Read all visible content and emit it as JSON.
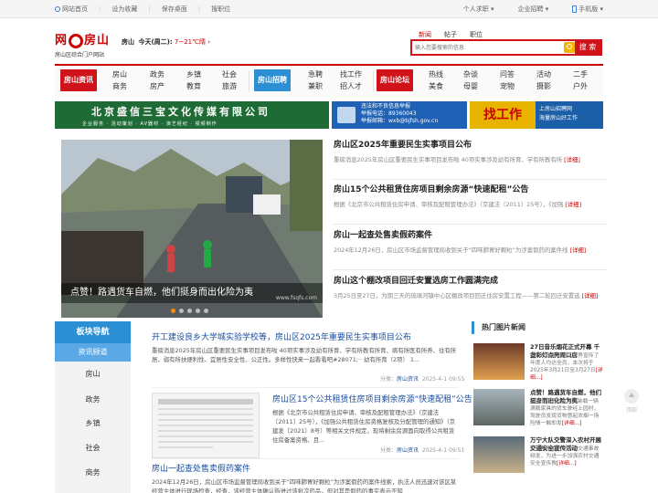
{
  "topbar": {
    "home": "网站首页",
    "favorite": "设为收藏",
    "desktop": "保存桌面",
    "report": "搜职位",
    "personal": "个人求职",
    "company": "企业招聘",
    "mobile": "手机版"
  },
  "logo": {
    "title_left": "网",
    "title_right": "房山",
    "subtitle": "房山区综合门户网站"
  },
  "weather": {
    "location": "房山",
    "today": "今天(周二):",
    "temp": "7~21℃晴"
  },
  "search": {
    "tabs": [
      "新闻",
      "帖子",
      "职位"
    ],
    "placeholder": "输入您要搜索的信息",
    "button": "搜 索"
  },
  "nav": {
    "blocks": [
      {
        "label": "房山资讯",
        "color": "#d0121b"
      },
      {
        "label": "房山招聘",
        "color": "#2c8fd4"
      },
      {
        "label": "房山论坛",
        "color": "#d0121b"
      }
    ],
    "group1": [
      [
        "房山",
        "商务"
      ],
      [
        "政务",
        "房产"
      ],
      [
        "乡镇",
        "教育"
      ],
      [
        "社会",
        "旅游"
      ]
    ],
    "group2": [
      [
        "急聘",
        "兼职"
      ],
      [
        "找工作",
        "招人才"
      ]
    ],
    "group3": [
      [
        "热线",
        "美食"
      ],
      [
        "杂谈",
        "母婴"
      ],
      [
        "问答",
        "宠物"
      ],
      [
        "活动",
        "摄影"
      ],
      [
        "二手",
        "户外"
      ]
    ]
  },
  "banners": {
    "b1_title": "北京盛信三宝文化传媒有限公司",
    "b1_sub": "企业服务 · 活动策划 · AV器材 · 演艺经纪 · 视频制作",
    "b2_line1": "违法和不良信息举报",
    "b2_line2": "举报电话：89360043",
    "b2_line3": "举报邮箱：wxb@bjfsh.gov.cn",
    "b3_big": "找工作",
    "b3_l1": "上房山招聘网",
    "b3_l2": "海量房山好工作"
  },
  "slide": {
    "caption": "点赞！路遇货车自燃，他们挺身而出化险为夷",
    "watermark": "www.fsqfs.com",
    "active_dot": 0,
    "dot_count": 5
  },
  "headlines": [
    {
      "title": "房山区2025年重要民生实事项目公布",
      "desc": "重磅消息2025年房山区重要民生实事项目发布啦 40项实事涉及幼有所育、学有所教有所",
      "more": "[详细]"
    },
    {
      "title": "房山15个公共租赁住房项目剩余房源“快速配租”公告",
      "desc": "根据《北京市公共租赁住房申请、审核及配租管理办法》（京建法〔2011〕25号），《加强",
      "more": "[详细]"
    },
    {
      "title": "房山一起查处售卖假药案件",
      "desc": "2024年12月26日，房山区市场监督管理局收到关于“四味肺胃好颗粒”为涉案假药的案件线",
      "more": "[详细]"
    },
    {
      "title": "房山这个棚改项目回迁安置选房工作圆满完成",
      "desc": "3月25日至27日，为期三天的琉璃河镇中心区棚改项目回迁住房安置工程——第二轮回迁安置选",
      "more": "[详细]"
    }
  ],
  "sidebar": {
    "header": "板块导航",
    "sub": "资讯频道",
    "items": [
      "房山",
      "政务",
      "乡镇",
      "社会",
      "商务"
    ]
  },
  "articles": [
    {
      "title": "开工建设良乡大学城实验学校等，房山区2025年重要民生实事项目公布",
      "desc": "重磅消息2025年房山区重要民生实事项目发布啦 40项实事涉及幼有所育、学有所教有所育、病有所医有所养、住有所居、弱有所扶便利性、宜居性安全性、公正性。多样性快来一起看看吧#28071;·· 幼有所育（2项） 1...",
      "cat_label": "分类：",
      "cat": "房山资讯",
      "date": "2025-4-1 09:55"
    },
    {
      "title": "房山区15个公共租赁住房项目剩余房源“快速配租”公告",
      "desc": "根据《北京市公共租赁住房申请、审核及配租管理办法》（京建法〔2011〕25号），《加强公共租赁住房资格复核及分配管理的通知》（京建发〔2021〕8号）等相关文件规定，现将剩余房源面向取得公共租赁住房备案资格、且...",
      "cat_label": "分类：",
      "cat": "房山资讯",
      "date": "2025-4-1 09:51"
    },
    {
      "title": "房山一起查处售卖假药案件",
      "desc": "2024年12月26日，房山区市场监督管理局收到关于“四味肺胃好颗粒”为涉案假药的案件线索，执法人员迅速对该区某经营主体进行现场检查，经查，该经营主体确认购进过该批次药品，但对其是假药的事实表示不知"
    }
  ],
  "hot": {
    "header": "热门图片新闻",
    "items": [
      {
        "title": "27日音乐烟花正式开幕 千盏彩灯点亮周口店",
        "desc": "近日永佩都市花花世界宣传了年度人均达全员，本次将于2025年3月21日至3月27日",
        "more": "[详细...]"
      },
      {
        "title": "点赞！路遇货车自燃，他们挺身而出化险为夷",
        "desc": "3月25日下午，河北装载一辆满载家具的货车驶经上园村，驾驶员发现货物冒起浓烟一场险情一触即发",
        "more": "[详细...]"
      },
      {
        "title": "万宁大队交警深入农村开展交通安全宣传活动",
        "desc": "近日年来制区北京人交通事故频发，为进一步加强农村交通安全宣传教",
        "more": "[详细...]"
      }
    ]
  },
  "float": {
    "label": "顶部"
  }
}
